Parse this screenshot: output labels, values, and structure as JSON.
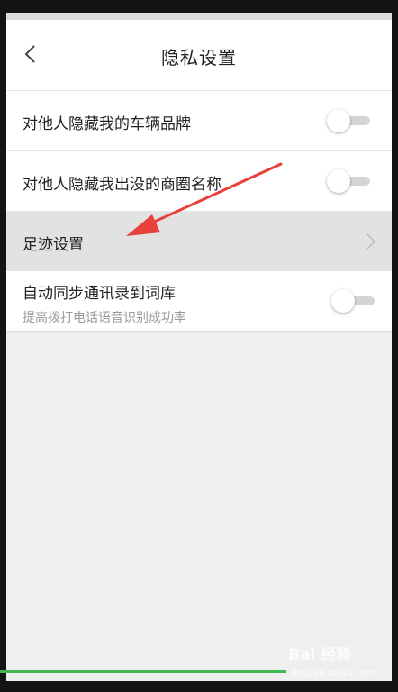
{
  "header": {
    "title": "隐私设置",
    "back_icon": "chevron-left-icon"
  },
  "settings": {
    "hide_brand": {
      "label": "对他人隐藏我的车辆品牌",
      "enabled": false
    },
    "hide_business_area": {
      "label": "对他人隐藏我出没的商圈名称",
      "enabled": false
    },
    "footprint": {
      "label": "足迹设置",
      "icon": "chevron-right-icon"
    },
    "sync_contacts": {
      "label": "自动同步通讯录到词库",
      "sublabel": "提高拨打电话语音识别成功率",
      "enabled": false
    }
  },
  "overlay": {
    "annotation_arrow_color": "#e8403a",
    "watermark_text": "Bai 经验",
    "watermark_url": "jingyan.baidu.com"
  },
  "video_progress": 0.72,
  "colors": {
    "background": "#efefef",
    "row_background": "#ffffff",
    "highlight_row": "#e2e2e2",
    "progress_bar": "#3fb950"
  }
}
